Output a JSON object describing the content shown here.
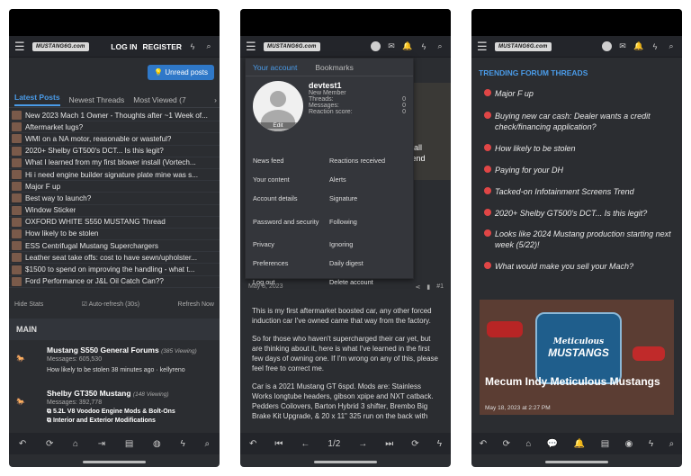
{
  "phone1": {
    "topbar": {
      "logo": "MUSTANG6G.com",
      "login": "LOG IN",
      "register": "REGISTER"
    },
    "unread_button": "Unread posts",
    "tabs": [
      {
        "label": "Latest Posts"
      },
      {
        "label": "Newest Threads"
      },
      {
        "label": "Most Viewed (7"
      }
    ],
    "threads": [
      "New 2023 Mach 1 Owner - Thoughts after ~1 Week of...",
      "Aftermarket lugs?",
      "WMI on a NA motor, reasonable or wasteful?",
      "2020+ Shelby GT500's DCT... Is this legit?",
      "What I learned from my first blower install (Vortech...",
      "Hi i need engine builder signature plate mine was s...",
      "Major F up",
      "Best way to launch?",
      "Window Sticker",
      "OXFORD WHITE S550 MUSTANG Thread",
      "How likely to be stolen",
      "ESS Centrifugal Mustang Superchargers",
      "Leather seat take offs: cost to have sewn/upholster...",
      "$1500 to spend on improving the handling - what t...",
      "Ford Performance or J&L Oil Catch Can??"
    ],
    "stats_bar": {
      "hide": "Hide Stats",
      "auto": "Auto-refresh (30s)",
      "refresh": "Refresh Now"
    },
    "main_header": "MAIN",
    "forums": [
      {
        "title": "Mustang S550 General Forums",
        "viewing": "(385 Viewing)",
        "messages": "Messages: 605,530",
        "last": "How likely to be stolen 38 minutes ago · kellyreno"
      },
      {
        "title": "Shelby GT350 Mustang",
        "viewing": "(148 Viewing)",
        "messages": "Messages: 392,778",
        "sub1": "5.2L V8 Voodoo Engine Mods & Bolt-Ons",
        "sub2": "Interior and Exterior Modifications"
      }
    ]
  },
  "phone2": {
    "account_tabs": [
      {
        "label": "Your account"
      },
      {
        "label": "Bookmarks"
      }
    ],
    "user": {
      "name": "devtest1",
      "role": "New Member",
      "threads_label": "Threads:",
      "threads": "0",
      "messages_label": "Messages:",
      "messages": "0",
      "reaction_label": "Reaction score:",
      "reaction": "0",
      "edit": "Edit"
    },
    "links_left": [
      "News feed",
      "Your content",
      "Account details",
      "Password and security",
      "Privacy",
      "Preferences",
      "Log out"
    ],
    "links_right": [
      "Reactions received",
      "Alerts",
      "Signature",
      "Following",
      "Ignoring",
      "Daily digest",
      "Delete account"
    ],
    "banner_text": "stall\nkend",
    "post_date": "May 8, 2023",
    "post_number": "#1",
    "paragraphs": [
      "This is my first aftermarket boosted car, any other forced induction car I've owned came that way from the factory.",
      "So for those who haven't supercharged their car yet, but are thinking about it, here is what I've learned in the first few days of owning one. If I'm wrong on any of this, please feel free to correct me.",
      "Car is a 2021 Mustang GT 6spd. Mods are: Stainless Works longtube headers, gibson xpipe and NXT catback. Pedders Coilovers, Barton Hybrid 3 shifter, Brembo Big Brake Kit Upgrade, & 20 x 11\" 325 run on the back with"
    ],
    "pager": "1/2"
  },
  "phone3": {
    "trending_header": "TRENDING FORUM THREADS",
    "trending": [
      "Major F up",
      "Buying new car cash: Dealer wants a credit check/financing application?",
      "How likely to be stolen",
      "Paying for your DH",
      "Tacked-on Infotainment Screens Trend",
      "2020+ Shelby GT500's DCT... Is this legit?",
      "Looks like 2024 Mustang production starting next week (5/22)!",
      "What would make you sell your Mach?"
    ],
    "feature": {
      "logo_top": "Meticulous",
      "logo_main": "MUSTANGS",
      "title": "Mecum Indy Meticulous Mustangs",
      "date": "May 18, 2023 at 2:27 PM"
    }
  },
  "colors": {
    "accent": "#4a9be8",
    "button": "#2f78c8",
    "trend_icon": "#e04646",
    "bg": "#2b2d31"
  }
}
